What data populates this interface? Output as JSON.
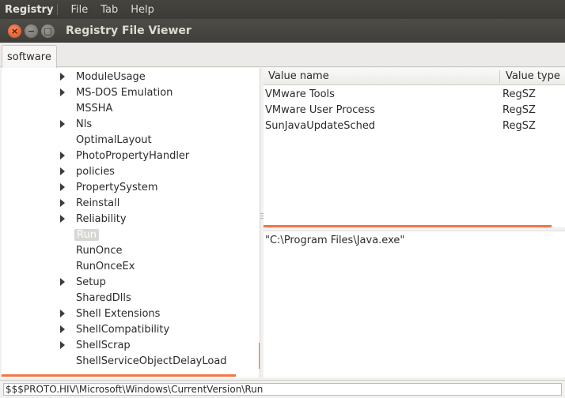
{
  "menubar": {
    "app_name": "Registry",
    "items": [
      "File",
      "Tab",
      "Help"
    ]
  },
  "window": {
    "title": "Registry File Viewer"
  },
  "tabs": [
    {
      "label": "software",
      "active": true
    }
  ],
  "tree": {
    "nodes": [
      {
        "label": "ModuleUsage",
        "has_children": true
      },
      {
        "label": "MS-DOS Emulation",
        "has_children": true
      },
      {
        "label": "MSSHA",
        "has_children": false
      },
      {
        "label": "Nls",
        "has_children": true
      },
      {
        "label": "OptimalLayout",
        "has_children": false
      },
      {
        "label": "PhotoPropertyHandler",
        "has_children": true
      },
      {
        "label": "policies",
        "has_children": true
      },
      {
        "label": "PropertySystem",
        "has_children": true
      },
      {
        "label": "Reinstall",
        "has_children": true
      },
      {
        "label": "Reliability",
        "has_children": true
      },
      {
        "label": "Run",
        "has_children": false,
        "selected": true
      },
      {
        "label": "RunOnce",
        "has_children": false
      },
      {
        "label": "RunOnceEx",
        "has_children": false
      },
      {
        "label": "Setup",
        "has_children": true
      },
      {
        "label": "SharedDlls",
        "has_children": false
      },
      {
        "label": "Shell Extensions",
        "has_children": true
      },
      {
        "label": "ShellCompatibility",
        "has_children": true
      },
      {
        "label": "ShellScrap",
        "has_children": true
      },
      {
        "label": "ShellServiceObjectDelayLoad",
        "has_children": false
      }
    ]
  },
  "values_table": {
    "headers": {
      "name": "Value name",
      "type": "Value type"
    },
    "rows": [
      {
        "name": "VMware Tools",
        "type": "RegSZ"
      },
      {
        "name": "VMware User Process",
        "type": "RegSZ"
      },
      {
        "name": "SunJavaUpdateSched",
        "type": "RegSZ"
      }
    ]
  },
  "value_content": "\"C:\\Program Files\\Java.exe\"",
  "status_path": "$$$PROTO.HIV\\Microsoft\\Windows\\CurrentVersion\\Run",
  "colors": {
    "accent": "#f07746",
    "close_button": "#e8612f",
    "titlebar": "#45443f"
  }
}
